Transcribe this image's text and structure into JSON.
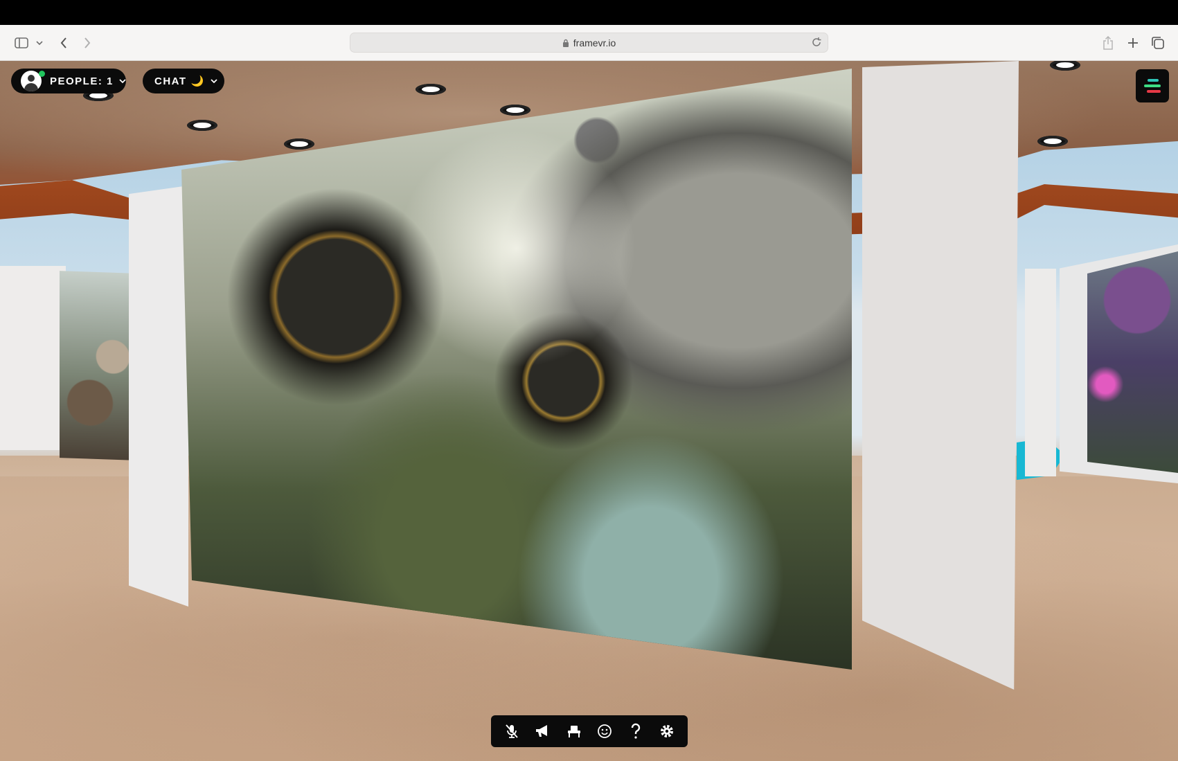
{
  "browser": {
    "url": "framevr.io",
    "buttons": [
      "sidebar-toggle",
      "tab-group-menu",
      "back",
      "forward",
      "reload",
      "share",
      "new-tab",
      "tab-overview"
    ]
  },
  "frame_ui": {
    "people_label": "PEOPLE: 1",
    "chat_label": "CHAT",
    "chat_icon": "🌙",
    "menu_icon": "menu-lines-icon",
    "dock": [
      "mic-muted-icon",
      "megaphone-icon",
      "seat-icon",
      "emoji-icon",
      "help-icon",
      "settings-icon"
    ]
  },
  "colors": {
    "ui_black": "#0b0b0b",
    "online_green": "#21c55d",
    "menu_teal": "#2ec4b6",
    "menu_green": "#3ddc84",
    "menu_red": "#e63946"
  }
}
